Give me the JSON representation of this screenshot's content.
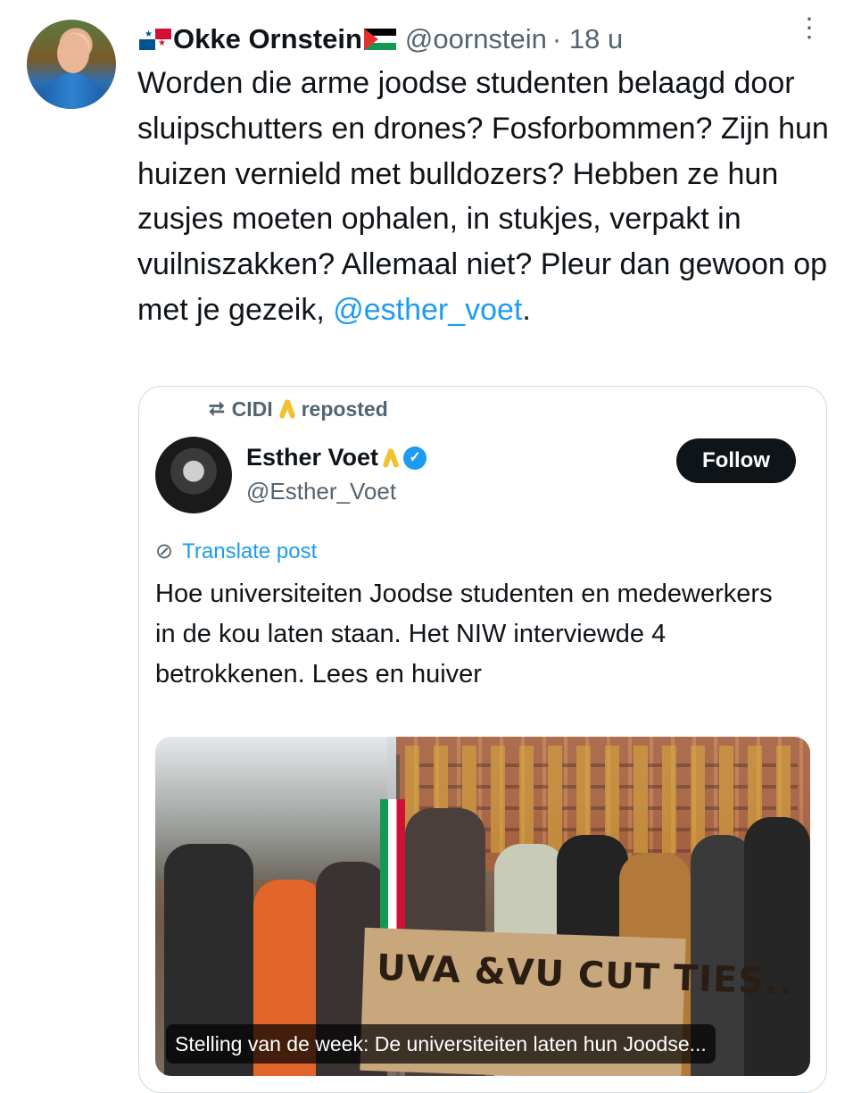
{
  "tweet": {
    "author_flag_left": "panama-flag",
    "author_name": "Okke Ornstein",
    "author_flag_right": "palestine-flag",
    "handle": "@oornstein",
    "time": "· 18 u",
    "body": "Worden die arme joodse studenten belaagd door sluipschutters en drones? Fosforbommen? Zijn hun huizen vernield met bulldozers? Hebben ze hun zusjes moeten ophalen, in stukjes, verpakt in vuilniszakken? Allemaal niet? Pleur dan gewoon op met je gezeik, ",
    "mention": "@esther_voet",
    "body_end": "."
  },
  "quote": {
    "repost_by": "CIDI",
    "repost_label": "reposted",
    "name": "Esther Voet",
    "handle": "@Esther_Voet",
    "follow_label": "Follow",
    "translate_label": "Translate post",
    "text": "Hoe universiteiten Joodse studenten en medewerkers in de kou laten staan. Het NIW interviewde 4 betrokkenen. Lees en huiver",
    "media_banner_text": "UVA &VU CUT TIES..",
    "media_caption": "Stelling van de week: De universiteiten laten hun Joodse..."
  },
  "colors": {
    "link": "#1d9bf0",
    "secondary_text": "#536471",
    "follow_bg": "#0f1419"
  }
}
